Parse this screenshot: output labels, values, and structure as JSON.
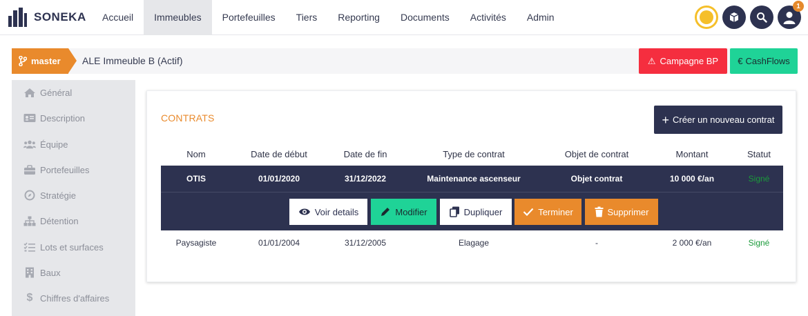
{
  "app": {
    "name": "SONEKA"
  },
  "nav": {
    "items": [
      "Accueil",
      "Immeubles",
      "Portefeuilles",
      "Tiers",
      "Reporting",
      "Documents",
      "Activités",
      "Admin"
    ],
    "active_label": "Immeubles"
  },
  "header_icons": {
    "notification_count": "1"
  },
  "branch": {
    "name": "master",
    "title": "ALE Immeuble B  (Actif)",
    "campagne_label": "Campagne BP",
    "cashflows_label": "CashFlows"
  },
  "sidebar": {
    "items": [
      {
        "label": "Général",
        "icon": "home-icon"
      },
      {
        "label": "Description",
        "icon": "id-card-icon"
      },
      {
        "label": "Équipe",
        "icon": "users-icon"
      },
      {
        "label": "Portefeuilles",
        "icon": "briefcase-icon"
      },
      {
        "label": "Stratégie",
        "icon": "compass-icon"
      },
      {
        "label": "Détention",
        "icon": "org-chart-icon"
      },
      {
        "label": "Lots et surfaces",
        "icon": "list-check-icon"
      },
      {
        "label": "Baux",
        "icon": "building-icon"
      },
      {
        "label": "Chiffres d'affaires",
        "icon": "dollar-icon"
      }
    ]
  },
  "contracts": {
    "title": "CONTRATS",
    "new_button": "Créer un nouveau contrat",
    "columns": [
      "Nom",
      "Date de début",
      "Date de fin",
      "Type de contrat",
      "Objet de contrat",
      "Montant",
      "Statut"
    ],
    "rows": [
      [
        "OTIS",
        "01/01/2020",
        "31/12/2022",
        "Maintenance ascenseur",
        "Objet contrat",
        "10 000 €/an",
        "Signé"
      ],
      [
        "Paysagiste",
        "01/01/2004",
        "31/12/2005",
        "Elagage",
        "-",
        "2 000 €/an",
        "Signé"
      ]
    ],
    "actions": {
      "view": "Voir details",
      "edit": "Modifier",
      "duplicate": "Dupliquer",
      "finish": "Terminer",
      "delete": "Supprimer"
    }
  }
}
